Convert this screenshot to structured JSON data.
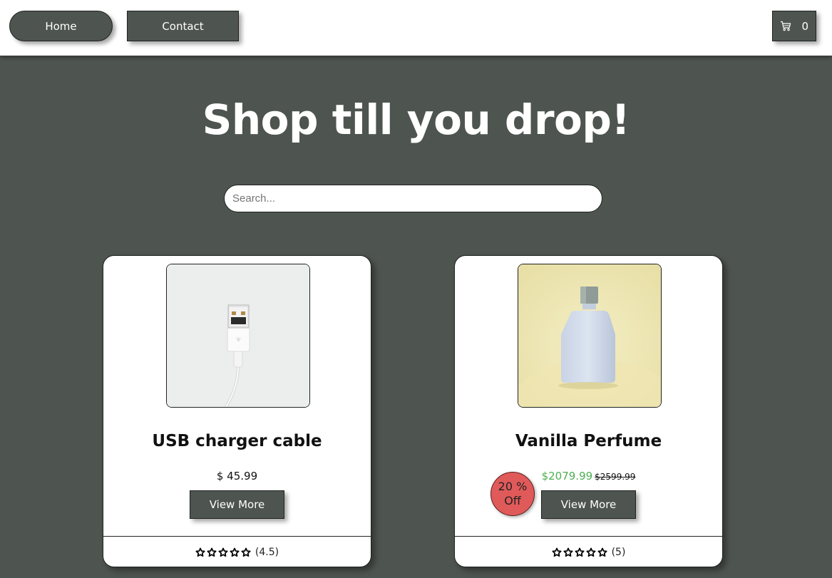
{
  "nav": {
    "home_label": "Home",
    "contact_label": "Contact",
    "cart_icon": "cart-icon",
    "cart_count": "0"
  },
  "hero": {
    "title": "Shop till you drop!"
  },
  "search": {
    "placeholder": "Search...",
    "value": ""
  },
  "products": [
    {
      "title": "USB charger cable",
      "price": "$ 45.99",
      "view_label": "View More",
      "rating": "(4.5)",
      "image_icon": "usb-cable-image"
    },
    {
      "title": "Vanilla Perfume",
      "sale_price": "$2079.99",
      "original_price": "$2599.99",
      "discount_line1": "20 %",
      "discount_line2": "Off",
      "view_label": "View More",
      "rating": "(5)",
      "image_icon": "perfume-bottle-image"
    }
  ],
  "colors": {
    "page_bg": "#4e5450",
    "button_bg": "#4e5450",
    "sale_green": "#4caf50",
    "discount_red": "#e05a5a"
  }
}
